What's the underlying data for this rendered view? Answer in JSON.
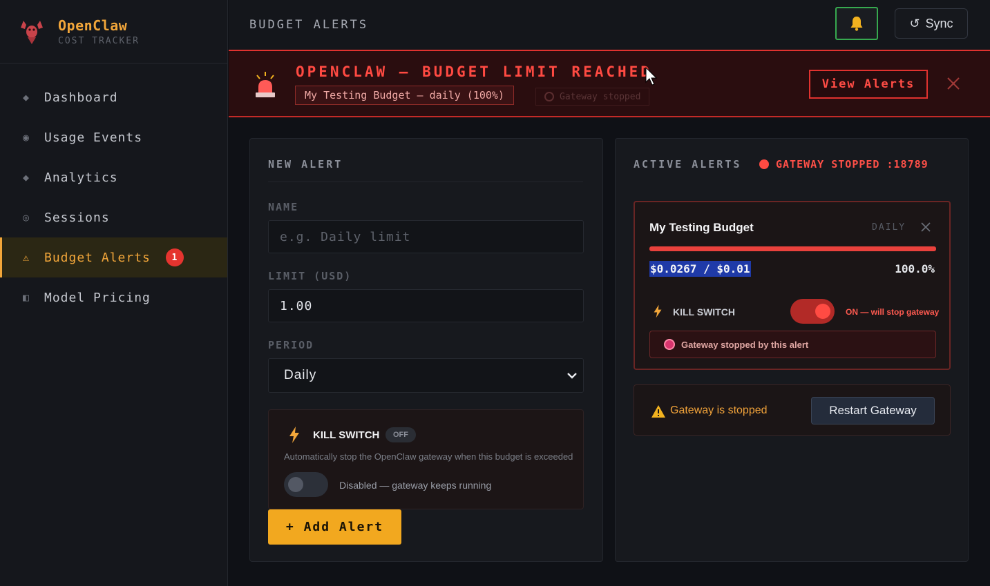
{
  "brand": {
    "title": "OpenClaw",
    "subtitle": "COST TRACKER"
  },
  "sidebar": {
    "items": [
      {
        "label": "Dashboard",
        "icon": "diamond-icon"
      },
      {
        "label": "Usage Events",
        "icon": "circle-dot-icon"
      },
      {
        "label": "Analytics",
        "icon": "diamond-icon"
      },
      {
        "label": "Sessions",
        "icon": "ring-icon"
      },
      {
        "label": "Budget Alerts",
        "icon": "warning-icon",
        "badge": "1",
        "active": true
      },
      {
        "label": "Model Pricing",
        "icon": "half-square-icon"
      }
    ]
  },
  "topbar": {
    "title": "BUDGET ALERTS",
    "sync_label": "Sync",
    "bell_icon": "bell-icon",
    "sync_icon": "refresh-icon"
  },
  "banner": {
    "title": "OPENCLAW — BUDGET LIMIT REACHED",
    "tag": "My Testing Budget — daily (100%)",
    "status": "Gateway stopped",
    "view_button": "View Alerts"
  },
  "new_alert": {
    "heading": "NEW ALERT",
    "name_label": "NAME",
    "name_placeholder": "e.g. Daily limit",
    "limit_label": "LIMIT (USD)",
    "limit_value": "1.00",
    "period_label": "PERIOD",
    "period_value": "Daily",
    "kill_switch": {
      "title": "KILL SWITCH",
      "state_badge": "OFF",
      "description": "Automatically stop the OpenClaw gateway when this budget is exceeded",
      "toggle_label": "Disabled — gateway keeps running"
    },
    "add_button": "+ Add Alert"
  },
  "active_alerts": {
    "heading": "ACTIVE ALERTS",
    "gateway_status": "GATEWAY STOPPED :18789",
    "alert": {
      "name": "My Testing Budget",
      "period": "DAILY",
      "spent": "$0.0267 / $0.01",
      "percent": "100.0%",
      "progress": 1.0,
      "kill_switch_label": "KILL SWITCH",
      "kill_switch_state": "ON — will stop gateway",
      "stopped_note": "Gateway stopped by this alert"
    },
    "restart": {
      "message": "Gateway is stopped",
      "button": "Restart Gateway"
    }
  },
  "colors": {
    "accent": "#f2a63a",
    "danger": "#e0322f",
    "success": "#37a94f"
  }
}
